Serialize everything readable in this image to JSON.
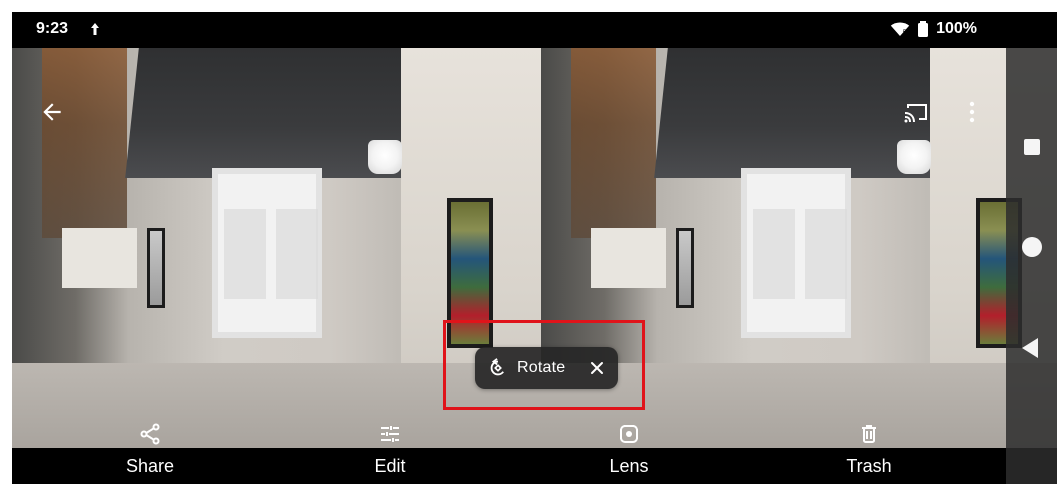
{
  "status_bar": {
    "time": "9:23",
    "battery_percent_text": "100%",
    "icons": {
      "upload": "upload-icon",
      "wifi": "wifi-icon",
      "battery": "battery-icon"
    }
  },
  "viewer": {
    "top_actions": {
      "back": "back-arrow-icon",
      "cast": "cast-icon",
      "more": "more-vert-icon"
    },
    "rotate_chip": {
      "label": "Rotate",
      "icons": {
        "rotate": "rotate-icon",
        "close": "close-icon"
      }
    }
  },
  "bottom_actions": [
    {
      "label": "Share",
      "icon": "share-icon"
    },
    {
      "label": "Edit",
      "icon": "tune-icon"
    },
    {
      "label": "Lens",
      "icon": "lens-icon"
    },
    {
      "label": "Trash",
      "icon": "trash-icon"
    }
  ],
  "nav_rail": {
    "recents": "recents-icon",
    "home": "home-icon",
    "back": "back-icon"
  },
  "colors": {
    "highlight_red": "#e0131a",
    "bar_black": "#000000",
    "chip_bg": "#262626"
  }
}
